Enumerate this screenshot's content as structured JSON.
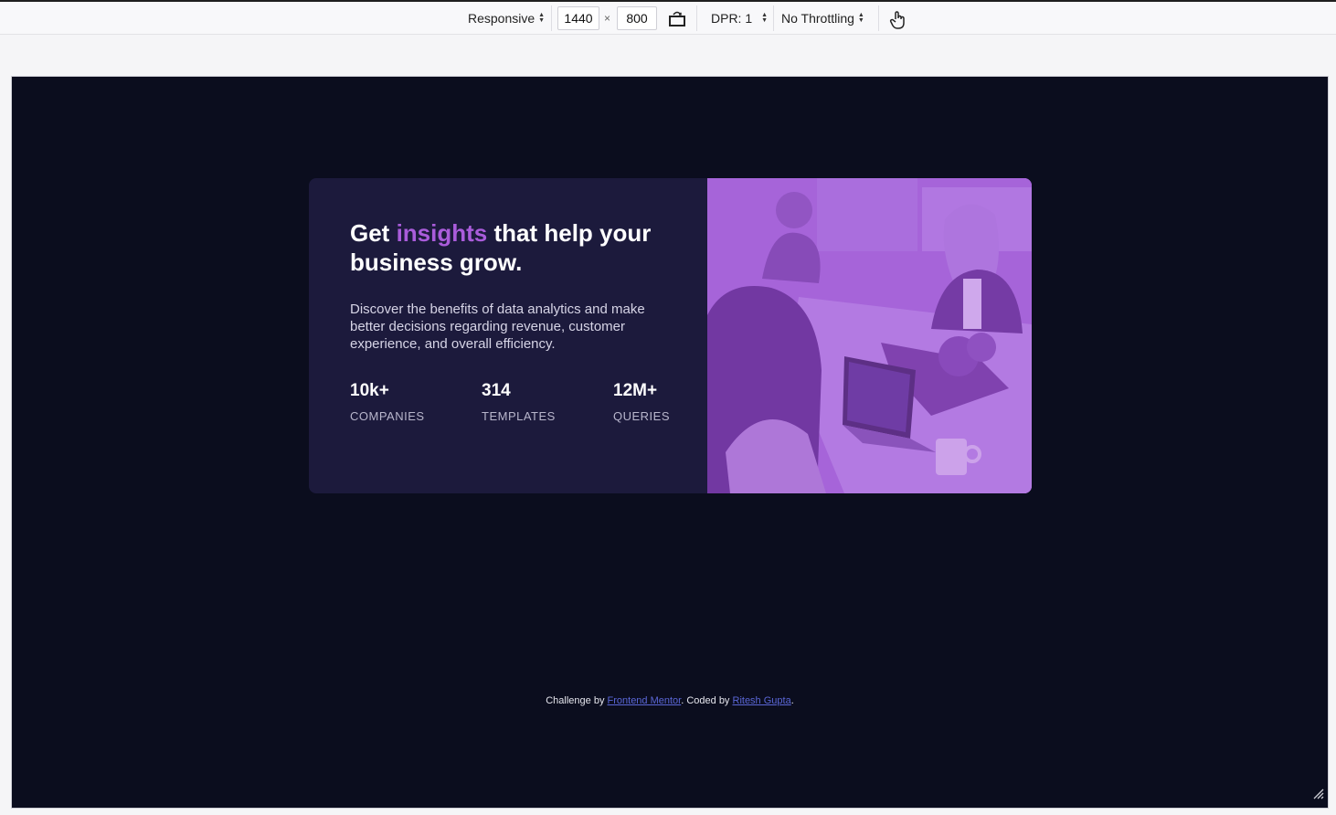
{
  "toolbar": {
    "device": "Responsive",
    "width": "1440",
    "times": "×",
    "height": "800",
    "dpr": "DPR: 1",
    "throttling": "No Throttling",
    "icons": [
      "rotate-icon",
      "touch-icon"
    ]
  },
  "card": {
    "headline_before": "Get ",
    "headline_accent": "insights",
    "headline_after": " that help your business grow.",
    "description": "Discover the benefits of data analytics and make better decisions regarding revenue, customer experience, and overall efficiency.",
    "stats": [
      {
        "value": "10k+",
        "label": "COMPANIES"
      },
      {
        "value": "314",
        "label": "TEMPLATES"
      },
      {
        "value": "12M+",
        "label": "QUERIES"
      }
    ]
  },
  "attribution": {
    "prefix": "Challenge by ",
    "link1": "Frontend Mentor",
    "middle": ". Coded by ",
    "link2": "Ritesh Gupta",
    "suffix": "."
  },
  "colors": {
    "page_bg": "#0b0d1e",
    "card_bg": "#1c1a3c",
    "accent": "#aa5cdb",
    "image_tint": "#a56ad8",
    "link": "#5a66d6"
  }
}
